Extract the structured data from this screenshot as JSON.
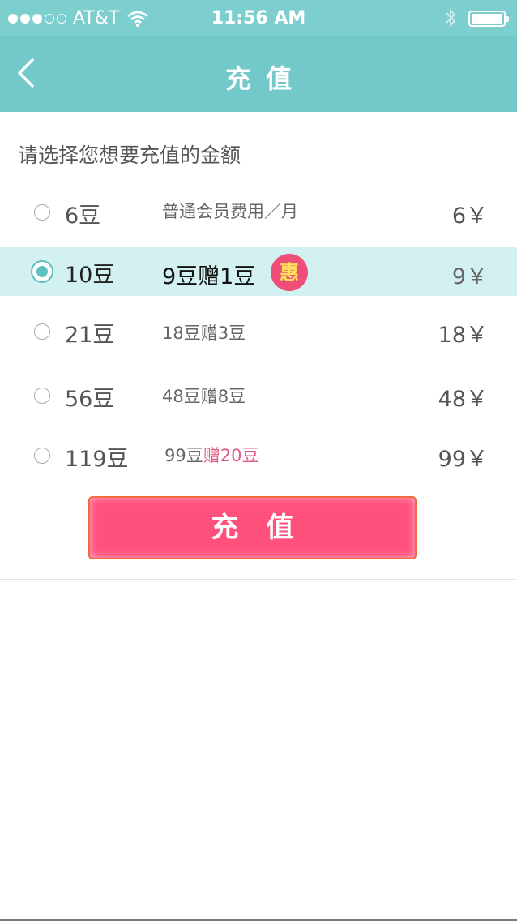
{
  "status_bar": {
    "carrier": "AT&T",
    "time": "11:56 AM",
    "signal_bars_filled": 3,
    "signal_bars_total": 5
  },
  "nav": {
    "title": "充值",
    "back_icon": "chevron-left-icon"
  },
  "prompt": "请选择您想要充值的金额",
  "options": [
    {
      "amount": "6豆",
      "desc": "普通会员费用／月",
      "desc_gift": "",
      "price": "6￥",
      "selected": false
    },
    {
      "amount": "10豆",
      "desc": "9豆赠1豆",
      "desc_gift": "",
      "price": "9￥",
      "selected": true,
      "badge": "惠"
    },
    {
      "amount": "21豆",
      "desc": "18豆赠3豆",
      "desc_gift": "",
      "price": "18￥",
      "selected": false
    },
    {
      "amount": "56豆",
      "desc": "48豆赠8豆",
      "desc_gift": "",
      "price": "48￥",
      "selected": false
    },
    {
      "amount": "119豆",
      "desc": "99豆",
      "desc_gift": "赠20豆",
      "price": "99￥",
      "selected": false
    }
  ],
  "submit_label": "充值",
  "colors": {
    "status_bar": "#7dcfcf",
    "nav_bar": "#73c9c9",
    "selected_row": "#d3f1f1",
    "accent_pink": "#ff517c",
    "gift_text": "#e25c82"
  }
}
